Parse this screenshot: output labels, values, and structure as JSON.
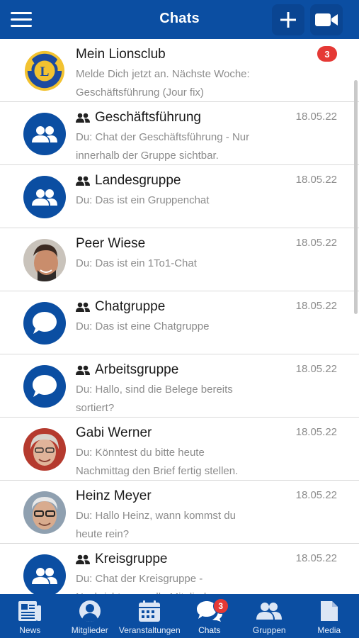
{
  "header": {
    "title": "Chats",
    "menu_icon": "hamburger-menu-icon",
    "add_icon": "plus-icon",
    "video_icon": "video-camera-icon"
  },
  "colors": {
    "brand": "#0b4ea2",
    "badge": "#e53935",
    "muted_text": "#8c8c8c"
  },
  "chats": [
    {
      "name": "Mein Lionsclub",
      "group": false,
      "avatar": "lions-club-logo",
      "preview_1": "Melde Dich jetzt an. Nächste Woche:",
      "preview_2": "Geschäftsführung (Jour fix)",
      "date": "",
      "badge": "3"
    },
    {
      "name": "Geschäftsführung",
      "group": true,
      "avatar": "group-avatar-icon",
      "preview_1": "Du: Chat der Geschäftsführung - Nur",
      "preview_2": "innerhalb der Gruppe sichtbar.",
      "date": "18.05.22",
      "badge": ""
    },
    {
      "name": "Landesgruppe",
      "group": true,
      "avatar": "group-avatar-icon",
      "preview_1": "Du: Das ist ein Gruppenchat",
      "preview_2": "",
      "date": "18.05.22",
      "badge": ""
    },
    {
      "name": "Peer Wiese",
      "group": false,
      "avatar": "person-photo-peer",
      "preview_1": "Du: Das ist ein 1To1-Chat",
      "preview_2": "",
      "date": "18.05.22",
      "badge": ""
    },
    {
      "name": "Chatgruppe",
      "group": true,
      "avatar": "chat-bubble-avatar-icon",
      "preview_1": "Du: Das ist eine Chatgruppe",
      "preview_2": "",
      "date": "18.05.22",
      "badge": ""
    },
    {
      "name": "Arbeitsgruppe",
      "group": true,
      "avatar": "chat-bubble-avatar-icon",
      "preview_1": "Du: Hallo, sind die Belege bereits",
      "preview_2": "sortiert?",
      "date": "18.05.22",
      "badge": ""
    },
    {
      "name": "Gabi Werner",
      "group": false,
      "avatar": "person-photo-gabi",
      "preview_1": "Du: Könntest du bitte heute",
      "preview_2": "Nachmittag den Brief fertig stellen.",
      "date": "18.05.22",
      "badge": ""
    },
    {
      "name": "Heinz Meyer",
      "group": false,
      "avatar": "person-photo-heinz",
      "preview_1": "Du: Hallo Heinz, wann kommst du",
      "preview_2": "heute rein?",
      "date": "18.05.22",
      "badge": ""
    },
    {
      "name": "Kreisgruppe",
      "group": true,
      "avatar": "group-avatar-icon",
      "preview_1": "Du: Chat der Kreisgruppe -",
      "preview_2": "Nachrichten an alle Mitglieder",
      "date": "18.05.22",
      "badge": ""
    }
  ],
  "bottom_nav": [
    {
      "label": "News",
      "icon": "newspaper-icon",
      "active": false,
      "badge": ""
    },
    {
      "label": "Mitglieder",
      "icon": "person-icon",
      "active": false,
      "badge": ""
    },
    {
      "label": "Veranstaltungen",
      "icon": "calendar-icon",
      "active": false,
      "badge": ""
    },
    {
      "label": "Chats",
      "icon": "chat-bubbles-icon",
      "active": true,
      "badge": "3"
    },
    {
      "label": "Gruppen",
      "icon": "group-icon",
      "active": false,
      "badge": ""
    },
    {
      "label": "Media",
      "icon": "document-icon",
      "active": false,
      "badge": ""
    }
  ]
}
